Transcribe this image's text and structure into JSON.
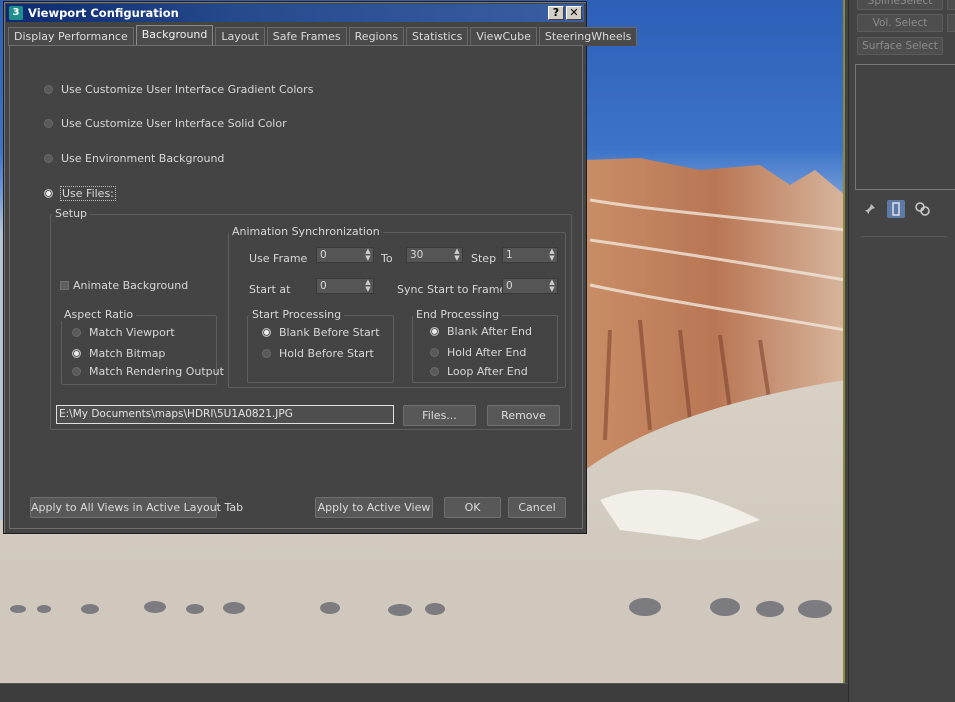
{
  "dialog": {
    "title": "Viewport Configuration",
    "help_button": "?",
    "close_button": "✕",
    "tabs": [
      "Display Performance",
      "Background",
      "Layout",
      "Safe Frames",
      "Regions",
      "Statistics",
      "ViewCube",
      "SteeringWheels"
    ],
    "active_tab": "Background",
    "source_options": [
      {
        "label": "Use Customize User Interface Gradient Colors",
        "selected": false
      },
      {
        "label": "Use Customize User Interface Solid Color",
        "selected": false
      },
      {
        "label": "Use Environment Background",
        "selected": false
      },
      {
        "label": "Use Files:",
        "selected": true
      }
    ],
    "setup": {
      "title": "Setup",
      "animate_background": {
        "label": "Animate Background",
        "checked": false
      },
      "aspect_ratio": {
        "title": "Aspect Ratio",
        "options": [
          {
            "label": "Match Viewport",
            "selected": false
          },
          {
            "label": "Match Bitmap",
            "selected": true
          },
          {
            "label": "Match Rendering Output",
            "selected": false
          }
        ]
      },
      "animation_sync": {
        "title": "Animation Synchronization",
        "use_frame_label": "Use Frame",
        "use_frame_value": "0",
        "to_label": "To",
        "to_value": "30",
        "step_label": "Step",
        "step_value": "1",
        "start_at_label": "Start at",
        "start_at_value": "0",
        "sync_start_label": "Sync Start to Frame",
        "sync_start_value": "0",
        "start_processing": {
          "title": "Start Processing",
          "options": [
            {
              "label": "Blank Before Start",
              "selected": true
            },
            {
              "label": "Hold Before Start",
              "selected": false
            }
          ]
        },
        "end_processing": {
          "title": "End Processing",
          "options": [
            {
              "label": "Blank After End",
              "selected": true
            },
            {
              "label": "Hold After End",
              "selected": false
            },
            {
              "label": "Loop After End",
              "selected": false
            }
          ]
        }
      },
      "file_path": "E:\\My Documents\\maps\\HDRI\\5U1A0821.JPG",
      "files_button": "Files...",
      "remove_button": "Remove"
    },
    "buttons": {
      "apply_all": "Apply to All Views in Active Layout Tab",
      "apply_active": "Apply to Active View",
      "ok": "OK",
      "cancel": "Cancel"
    }
  },
  "command_panel": {
    "buttons": [
      "SplineSelect",
      "Vol. Select",
      "Surface Select"
    ],
    "icons": [
      "pin-icon",
      "modifier-stack-icon",
      "configure-icon"
    ]
  },
  "colors": {
    "title_bar": "#0c2a70",
    "dialog_bg": "#444444",
    "sky": "#3d74c9",
    "cliff": "#b5704a",
    "sand": "#d9d3c8"
  }
}
